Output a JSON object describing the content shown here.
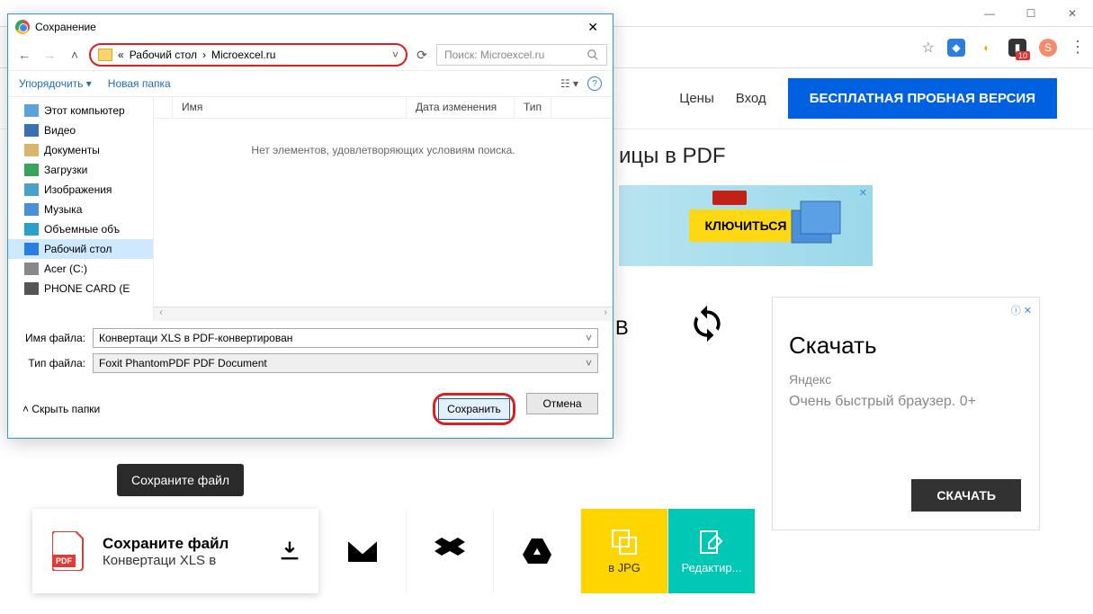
{
  "window": {
    "min": "—",
    "max": "☐",
    "close": "✕"
  },
  "site": {
    "nav_prices": "Цены",
    "nav_login": "Вход",
    "trial_btn": "БЕСПЛАТНАЯ ПРОБНАЯ ВЕРСИЯ",
    "page_title_partial": "ицы в PDF"
  },
  "ext_badge": "10",
  "ext_letter": "S",
  "ad_banner": {
    "btn": "КЛЮЧИТЬСЯ",
    "close": "✕"
  },
  "side_ad": {
    "title": "Скачать",
    "sub": "Яндекс",
    "desc": "Очень быстрый браузер. 0+",
    "btn": "СКАЧАТЬ",
    "adx": "ⓘ ✕"
  },
  "refresh_label": "В",
  "tooltip": "Сохраните файл",
  "cards": {
    "first_title": "Сохраните файл",
    "first_sub": "Конвертаци XLS в",
    "jpg": "в JPG",
    "edit": "Редактир..."
  },
  "dialog": {
    "title": "Сохранение",
    "bc_prefix": "«",
    "bc1": "Рабочий стол",
    "bc2": "Microexcel.ru",
    "search_placeholder": "Поиск: Microexcel.ru",
    "organize": "Упорядочить",
    "new_folder": "Новая папка",
    "col_name": "Имя",
    "col_date": "Дата изменения",
    "col_type": "Тип",
    "empty": "Нет элементов, удовлетворяющих условиям поиска.",
    "tree": {
      "pc": "Этот компьютер",
      "video": "Видео",
      "docs": "Документы",
      "downloads": "Загрузки",
      "images": "Изображения",
      "music": "Музыка",
      "objects": "Объемные объ",
      "desktop": "Рабочий стол",
      "acer": "Acer (C:)",
      "phone": "PHONE CARD (E"
    },
    "label_filename": "Имя файла:",
    "filename_value": "Конвертаци XLS в PDF-конвертирован",
    "label_filetype": "Тип файла:",
    "filetype_value": "Foxit PhantomPDF PDF Document",
    "hide_folders": "Скрыть папки",
    "save_btn": "Сохранить",
    "cancel_btn": "Отмена"
  }
}
